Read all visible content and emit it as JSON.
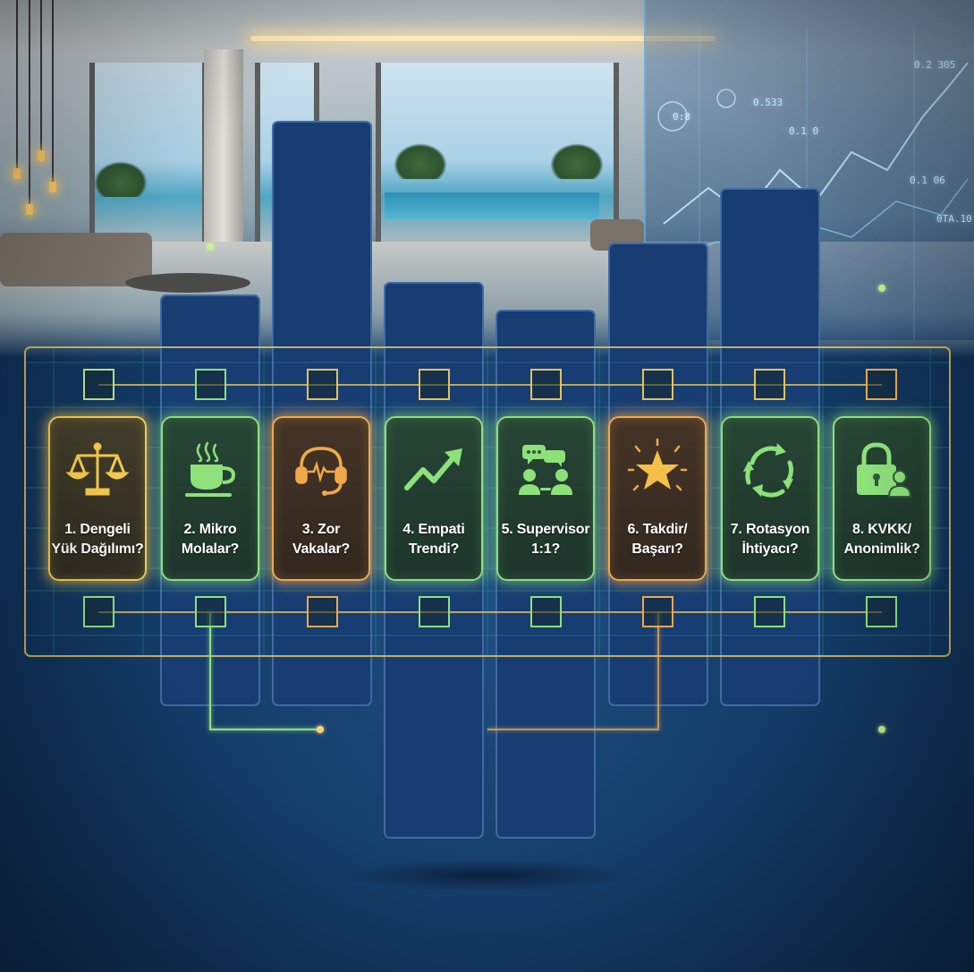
{
  "hud_readouts": [
    "0.2 305",
    "0.533",
    "0.1 06",
    "0.1 0",
    "0TA.10",
    "0:8"
  ],
  "steps": [
    {
      "number": "1.",
      "title": "Dengeli\nYük Dağılımı?",
      "icon": "scale-icon",
      "style": "gold"
    },
    {
      "number": "2.",
      "title": "Mikro\nMolalar?",
      "icon": "coffee-cup-icon",
      "style": "green"
    },
    {
      "number": "3.",
      "title": "Zor\nVakalar?",
      "icon": "headset-icon",
      "style": "orange"
    },
    {
      "number": "4.",
      "title": "Empati\nTrendi?",
      "icon": "trend-up-icon",
      "style": "green"
    },
    {
      "number": "5.",
      "title": "Supervisor\n1:1?",
      "icon": "chat-people-icon",
      "style": "green"
    },
    {
      "number": "6.",
      "title": "Takdir/\nBaşarı?",
      "icon": "star-icon",
      "style": "orange"
    },
    {
      "number": "7.",
      "title": "Rotasyon\nİhtiyacı?",
      "icon": "rotation-icon",
      "style": "green"
    },
    {
      "number": "8.",
      "title": "KVKK/\nAnonimlik?",
      "icon": "lock-user-icon",
      "style": "green"
    }
  ],
  "colors": {
    "bar_fill": "#183d72",
    "bar_edge": "#3e6aa6",
    "gold": "#f2c94c",
    "orange": "#f0a94a",
    "green": "#8de07a"
  }
}
